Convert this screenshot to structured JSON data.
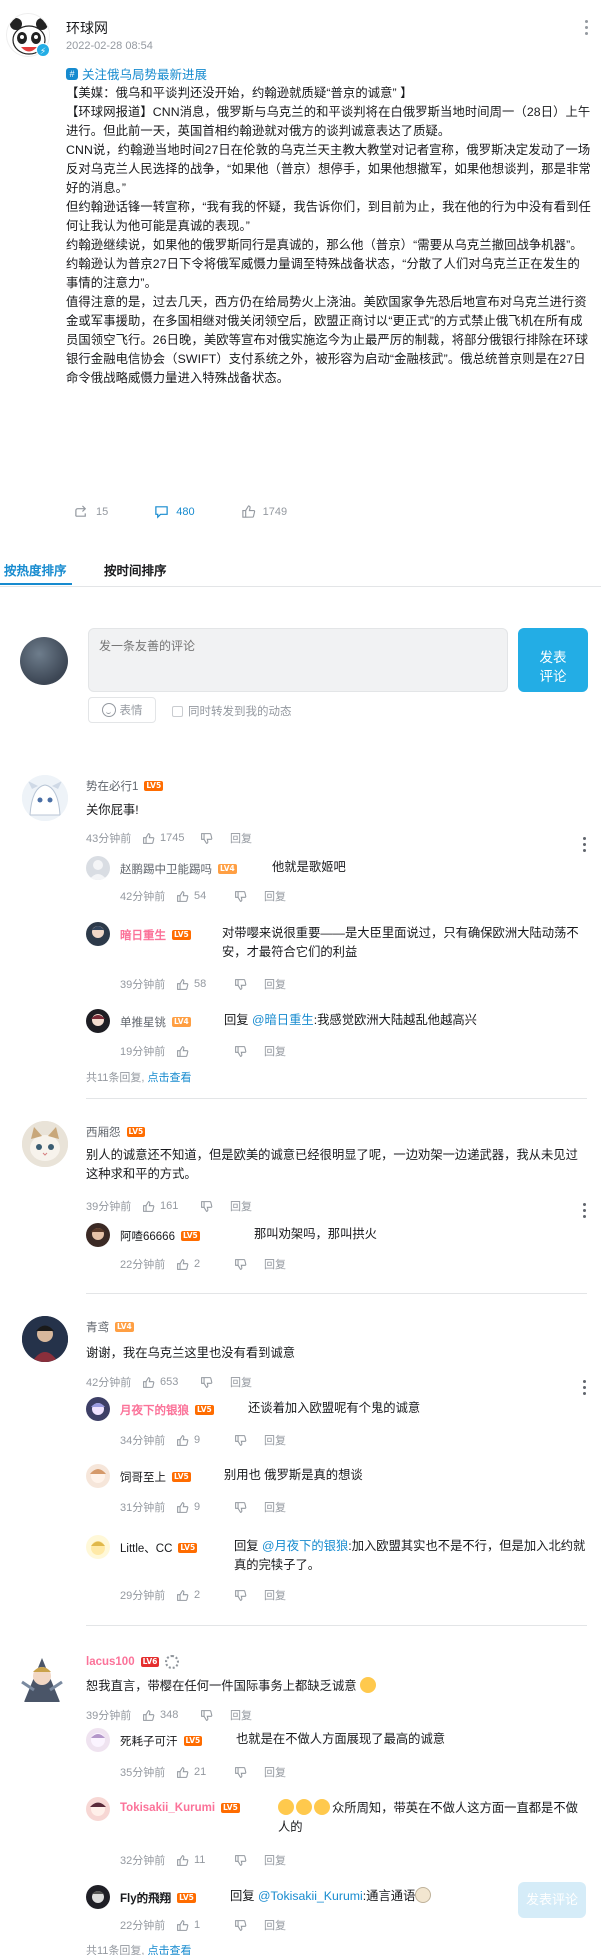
{
  "post": {
    "author": "环球网",
    "time": "2022-02-28 08:54",
    "topic": "关注俄乌局势最新进展",
    "paragraphs": [
      "【美媒：俄乌和平谈判还没开始，约翰逊就质疑“普京的诚意” 】",
      "【环球网报道】CNN消息，俄罗斯与乌克兰的和平谈判将在白俄罗斯当地时间周一（28日）上午进行。但此前一天，英国首相约翰逊就对俄方的谈判诚意表达了质疑。",
      "CNN说，约翰逊当地时间27日在伦敦的乌克兰天主教大教堂对记者宣称，俄罗斯决定发动了一场反对乌克兰人民选择的战争，“如果他（普京）想停手，如果他想撤军，如果他想谈判，那是非常好的消息。”",
      "但约翰逊话锋一转宣称，“我有我的怀疑，我告诉你们，到目前为止，我在他的行为中没有看到任何让我认为他可能是真诚的表现。”",
      "约翰逊继续说，如果他的俄罗斯同行是真诚的，那么他（普京）“需要从乌克兰撤回战争机器”。约翰逊认为普京27日下令将俄军威慑力量调至特殊战备状态，“分散了人们对乌克兰正在发生的事情的注意力”。",
      "值得注意的是，过去几天，西方仍在给局势火上浇油。美欧国家争先恐后地宣布对乌克兰进行资金或军事援助，在多国相继对俄关闭领空后，欧盟正商讨以“更正式”的方式禁止俄飞机在所有成员国领空飞行。26日晚，美欧等宣布对俄实施迄今为止最严厉的制裁，将部分俄银行排除在环球银行金融电信协会（SWIFT）支付系统之外，被形容为启动“金融核武”。俄总统普京则是在27日命令俄战略威慑力量进入特殊战备状态。"
    ],
    "forward_count": "15",
    "comment_count": "480",
    "like_count": "1749"
  },
  "tabs": {
    "hot": "按热度排序",
    "time": "按时间排序"
  },
  "composer": {
    "placeholder": "发一条友善的评论",
    "submit_line1": "发表",
    "submit_line2": "评论",
    "emoji": "表情",
    "forward": "同时转发到我的动态"
  },
  "labels": {
    "reply": "回复",
    "total_prefix": "共",
    "total_suffix": "条回复,",
    "view_more": "点击查看",
    "reply_at": "回复 "
  },
  "comments": [
    {
      "user": "势在必行1",
      "level": "LV5",
      "text": "关你屁事!",
      "time": "43分钟前",
      "likes": "1745",
      "replies": [
        {
          "user": "赵鹏踢中卫能踢吗",
          "level": "LV4",
          "text": "他就是歌姬吧",
          "time": "42分钟前",
          "likes": "54"
        },
        {
          "user": "暗日重生",
          "level": "LV5",
          "text": "对带嘤来说很重要——是大臣里面说过，只有确保欧洲大陆动荡不安，才最符合它们的利益",
          "time": "39分钟前",
          "likes": "58"
        },
        {
          "user": "单推星铫",
          "level": "LV4",
          "at": "@暗日重生",
          "text": ":我感觉欧洲大陆越乱他越高兴",
          "time": "19分钟前",
          "likes": ""
        }
      ],
      "total": "11"
    },
    {
      "user": "西厢怨",
      "level": "LV5",
      "text": "别人的诚意还不知道，但是欧美的诚意已经很明显了呢，一边劝架一边递武器，我从未见过这种求和平的方式。",
      "time": "39分钟前",
      "likes": "161",
      "replies": [
        {
          "user": "阿喳66666",
          "level": "LV5",
          "text": "那叫劝架吗，那叫拱火",
          "time": "22分钟前",
          "likes": "2"
        }
      ]
    },
    {
      "user": "青鸢",
      "level": "LV4",
      "text": "谢谢，我在乌克兰这里也没有看到诚意",
      "time": "42分钟前",
      "likes": "653",
      "replies": [
        {
          "user": "月夜下的银狼",
          "level": "LV5",
          "text": "还谈着加入欧盟呢有个鬼的诚意",
          "time": "34分钟前",
          "likes": "9"
        },
        {
          "user": "饲哥至上",
          "level": "LV5",
          "text": "别用也  俄罗斯是真的想谈",
          "time": "31分钟前",
          "likes": "9"
        },
        {
          "user": "Little、CC",
          "level": "LV5",
          "at": "@月夜下的银狼",
          "text": ":加入欧盟其实也不是不行，但是加入北约就真的完犊子了。",
          "time": "29分钟前",
          "likes": "2"
        }
      ]
    },
    {
      "user": "lacus100",
      "level": "LV6",
      "text": "恕我直言，带樱在任何一件国际事务上都缺乏诚意",
      "time": "39分钟前",
      "likes": "348",
      "replies": [
        {
          "user": "死耗子可汗",
          "level": "LV5",
          "text": "也就是在不做人方面展现了最高的诚意",
          "time": "35分钟前",
          "likes": "21"
        },
        {
          "user": "Tokisakii_Kurumi",
          "level": "LV5",
          "text": "众所周知，带英在不做人这方面一直都是不做人的",
          "time": "32分钟前",
          "likes": "11"
        },
        {
          "user": "Fly的飛翔",
          "level": "LV5",
          "at": "@Tokisakii_Kurumi",
          "text": ":通言通语",
          "time": "22分钟前",
          "likes": "1"
        }
      ],
      "total": "11"
    }
  ],
  "float_button": "发表评论"
}
